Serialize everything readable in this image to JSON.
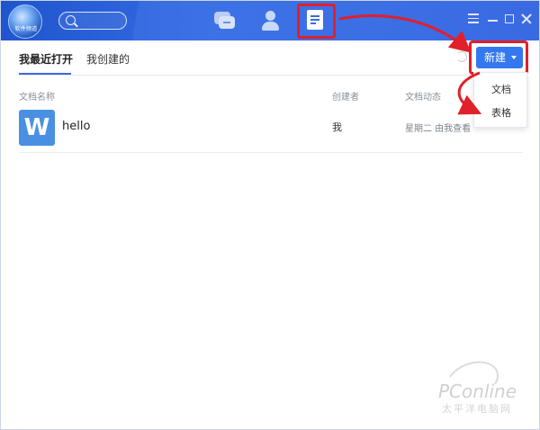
{
  "header": {
    "logo_top": "",
    "logo_label": "软件频道",
    "nav": [
      "chat-icon",
      "contacts-icon",
      "documents-icon"
    ]
  },
  "tabs": [
    {
      "label": "我最近打开",
      "active": true
    },
    {
      "label": "我创建的",
      "active": false
    }
  ],
  "new_button": {
    "label": "新建"
  },
  "new_menu": {
    "items": [
      "文档",
      "表格"
    ]
  },
  "table": {
    "columns": [
      "文档名称",
      "创建者",
      "文档动态"
    ],
    "rows": [
      {
        "icon_letter": "W",
        "name": "hello",
        "creator": "我",
        "activity": "星期二 由我查看"
      }
    ]
  },
  "watermark": {
    "brand": "PConline",
    "sub": "太平洋电脑网",
    "small": ""
  },
  "colors": {
    "header": "#3a6ae2",
    "accent": "#3478f0",
    "highlight": "#e0202a",
    "file_icon": "#4a90e2"
  }
}
